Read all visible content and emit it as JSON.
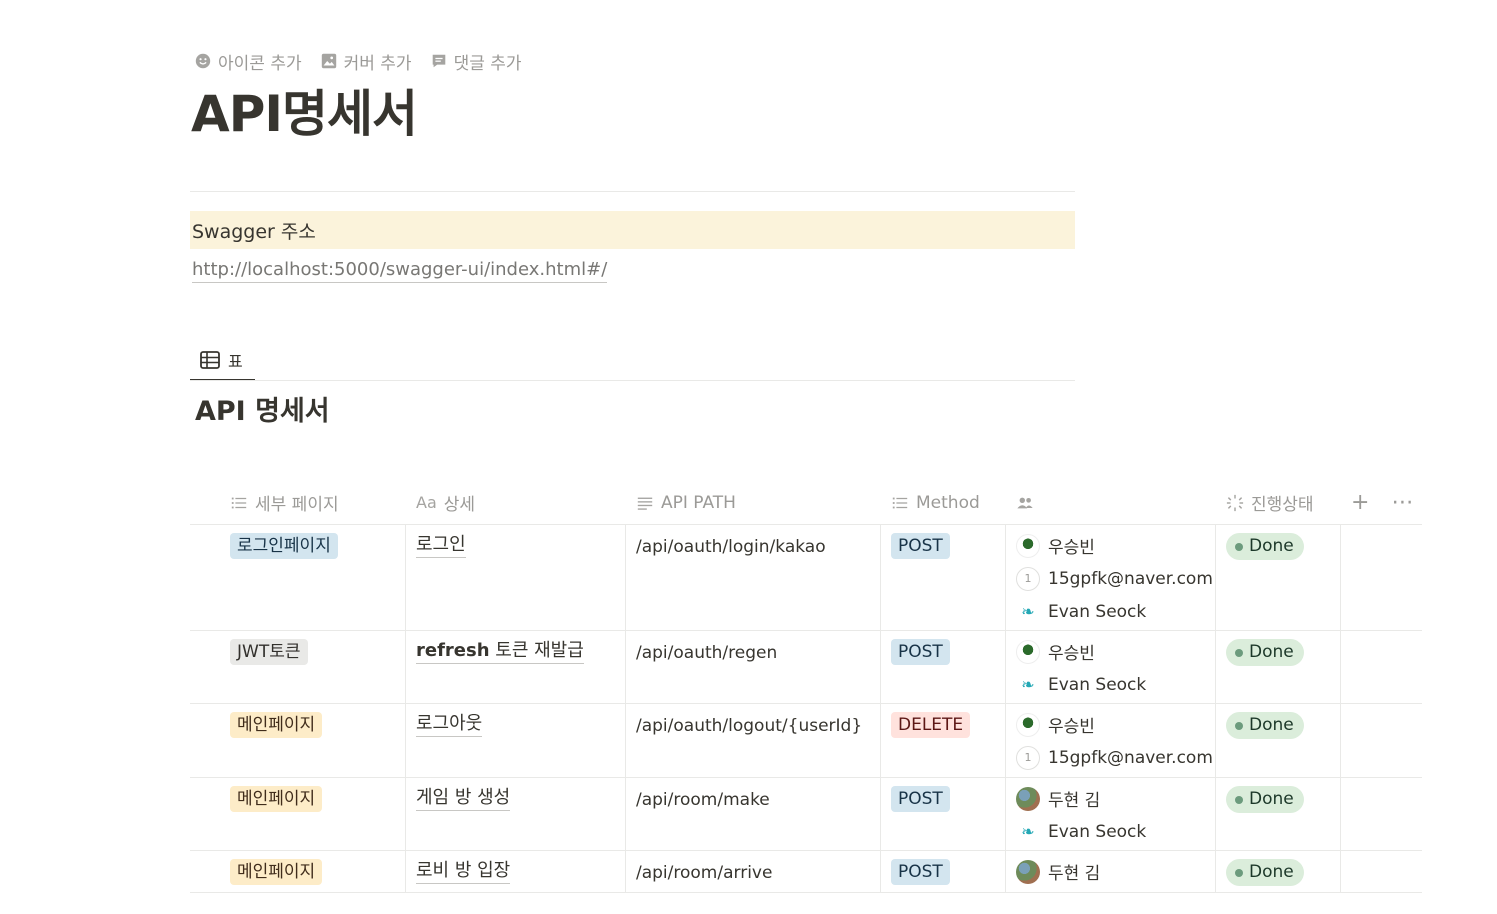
{
  "page_controls": {
    "add_icon": "아이콘 추가",
    "add_cover": "커버 추가",
    "add_comment": "댓글 추가"
  },
  "page": {
    "title": "API명세서"
  },
  "callout": {
    "text": "Swagger 주소"
  },
  "swagger_link": "http://localhost:5000/swagger-ui/index.html#/",
  "view_tab": {
    "label": "표"
  },
  "database": {
    "title": "API 명세서",
    "columns": {
      "page": "세부 페이지",
      "detail": "상세",
      "path": "API PATH",
      "method": "Method",
      "people": "",
      "status": "진행상태"
    },
    "rows": [
      {
        "page": "로그인페이지",
        "detail": "로그인",
        "path": "/api/oauth/login/kakao",
        "method": "POST",
        "people": [
          "우승빈",
          "15gpfk@naver.com",
          "Evan Seock"
        ],
        "status": "Done"
      },
      {
        "page": "JWT토큰",
        "detail_bold": "refresh",
        "detail": " 토큰 재발급",
        "path": "/api/oauth/regen",
        "method": "POST",
        "people": [
          "우승빈",
          "Evan Seock"
        ],
        "status": "Done"
      },
      {
        "page": "메인페이지",
        "detail": "로그아웃",
        "path": "/api/oauth/logout/{userId}",
        "method": "DELETE",
        "people": [
          "우승빈",
          "15gpfk@naver.com"
        ],
        "status": "Done"
      },
      {
        "page": "메인페이지",
        "detail": "게임 방 생성",
        "path": "/api/room/make",
        "method": "POST",
        "people": [
          "두현 김",
          "Evan Seock"
        ],
        "status": "Done"
      },
      {
        "page": "메인페이지",
        "detail": "로비 방 입장",
        "path": "/api/room/arrive",
        "method": "POST",
        "people": [
          "두현 김"
        ],
        "status": "Done"
      }
    ]
  },
  "email_avatar_number": "1",
  "colors": {
    "text": "#37352f",
    "muted": "#9b9a97",
    "callout_bg": "#fbf3db",
    "tag_blue": "#d3e5ef",
    "tag_gray": "#e9e9e7",
    "tag_orange": "#fdecc8",
    "tag_red": "#ffe2dd",
    "status_green": "#dbeddb"
  }
}
